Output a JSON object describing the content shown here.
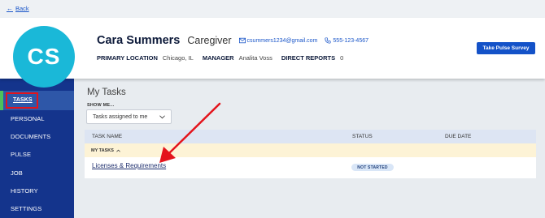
{
  "nav_back": {
    "label": "Back"
  },
  "profile": {
    "initials": "CS",
    "name": "Cara Summers",
    "role": "Caregiver",
    "email": "csummers1234@gmail.com",
    "phone": "555-123-4567",
    "primary_location_label": "PRIMARY LOCATION",
    "primary_location": "Chicago, IL",
    "manager_label": "MANAGER",
    "manager": "Analita Voss",
    "direct_reports_label": "DIRECT REPORTS",
    "direct_reports": "0",
    "pulse_button": "Take Pulse Survey",
    "avatar_color": "#1ab8d8"
  },
  "sidebar": {
    "items": [
      {
        "label": "TASKS",
        "active": true
      },
      {
        "label": "PERSONAL"
      },
      {
        "label": "DOCUMENTS"
      },
      {
        "label": "PULSE"
      },
      {
        "label": "JOB"
      },
      {
        "label": "HISTORY"
      },
      {
        "label": "SETTINGS"
      }
    ],
    "bg_color": "#14348c",
    "highlight_color": "#e4141c"
  },
  "main": {
    "title": "My Tasks",
    "filter_label": "SHOW ME...",
    "filter_value": "Tasks assigned to me",
    "table": {
      "columns": [
        "TASK NAME",
        "STATUS",
        "DUE DATE"
      ],
      "group_label": "MY TASKS",
      "rows": [
        {
          "task": "Licenses & Requirements",
          "status": "NOT STARTED",
          "due": ""
        }
      ]
    }
  },
  "colors": {
    "accent": "#1452c8",
    "annotation": "#e4141c"
  }
}
